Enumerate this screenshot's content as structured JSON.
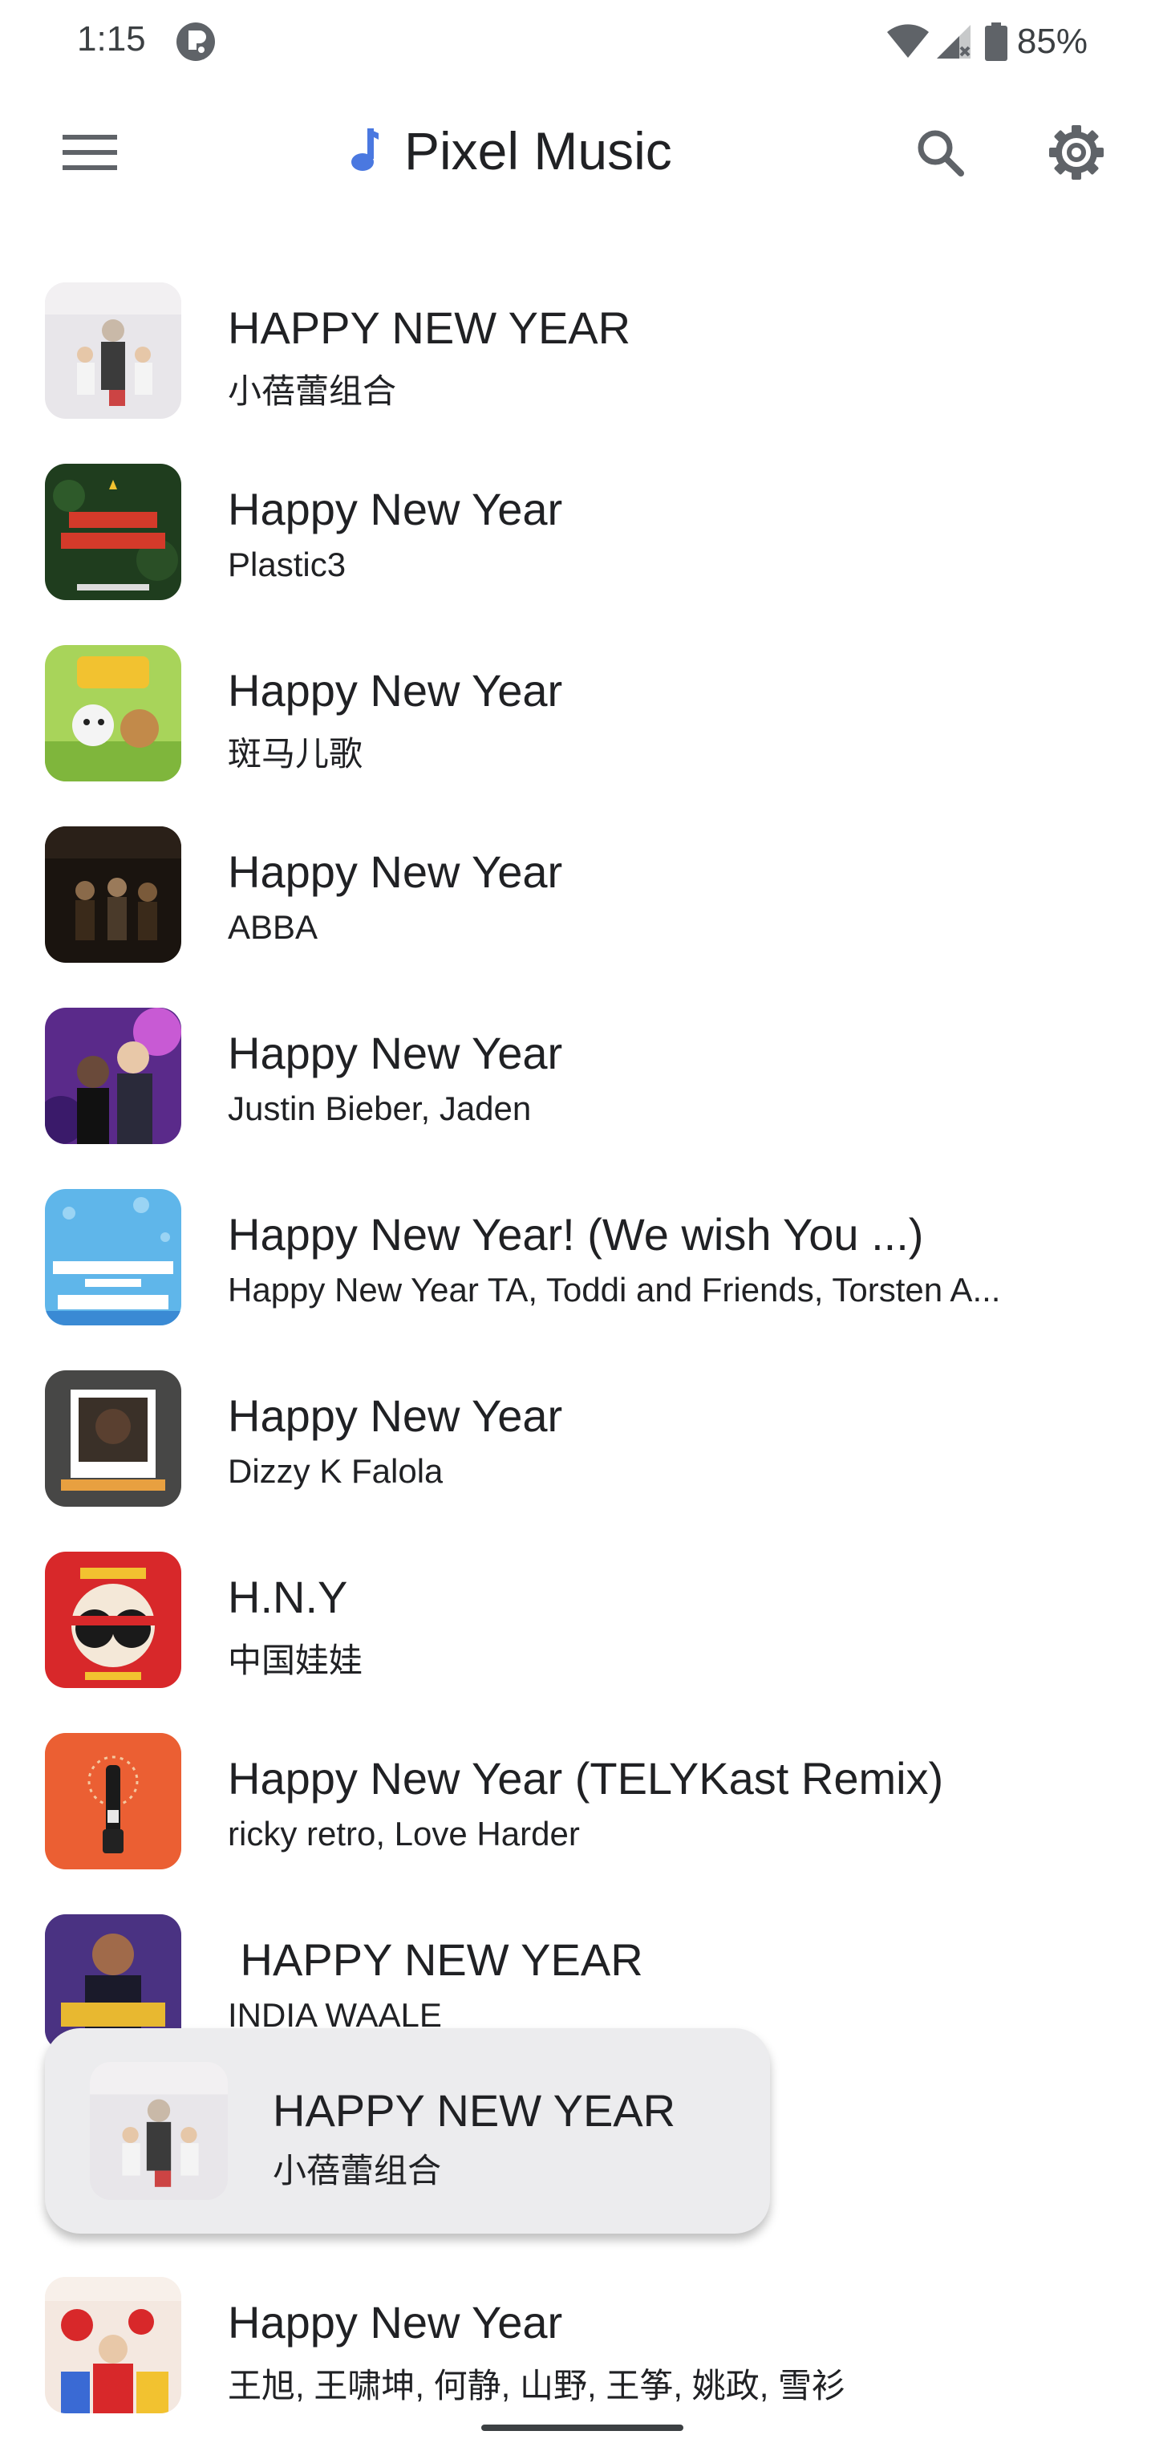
{
  "status_bar": {
    "time": "1:15",
    "battery": "85%",
    "icons": [
      "app-notification-icon",
      "wifi-icon",
      "signal-icon",
      "battery-icon"
    ]
  },
  "app_bar": {
    "title": "Pixel Music",
    "icons": [
      "menu-icon",
      "music-note-icon",
      "search-icon",
      "settings-icon"
    ],
    "accent": "#4a78e0"
  },
  "songs": [
    {
      "title": "HAPPY NEW YEAR",
      "artist": "小蓓蕾组合"
    },
    {
      "title": "Happy New Year",
      "artist": "Plastic3"
    },
    {
      "title": "Happy New Year",
      "artist": "斑马儿歌"
    },
    {
      "title": "Happy New Year",
      "artist": "ABBA"
    },
    {
      "title": "Happy New Year",
      "artist": "Justin Bieber, Jaden"
    },
    {
      "title": "Happy New Year! (We wish You ...)",
      "artist": "Happy New Year TA, Toddi and Friends, Torsten A..."
    },
    {
      "title": "Happy New Year",
      "artist": "Dizzy K Falola"
    },
    {
      "title": "H.N.Y",
      "artist": "中国娃娃"
    },
    {
      "title": "Happy New Year (TELYKast Remix)",
      "artist": "ricky retro, Love Harder"
    },
    {
      "title": " HAPPY NEW YEAR",
      "artist": "INDIA WAALE"
    },
    {
      "title": "",
      "artist": ""
    },
    {
      "title": "Happy New Year",
      "artist": "王旭, 王啸坤, 何静, 山野, 王筝, 姚政, 雪衫"
    }
  ],
  "mini_player": {
    "title": "HAPPY NEW YEAR",
    "artist": "小蓓蕾组合"
  }
}
